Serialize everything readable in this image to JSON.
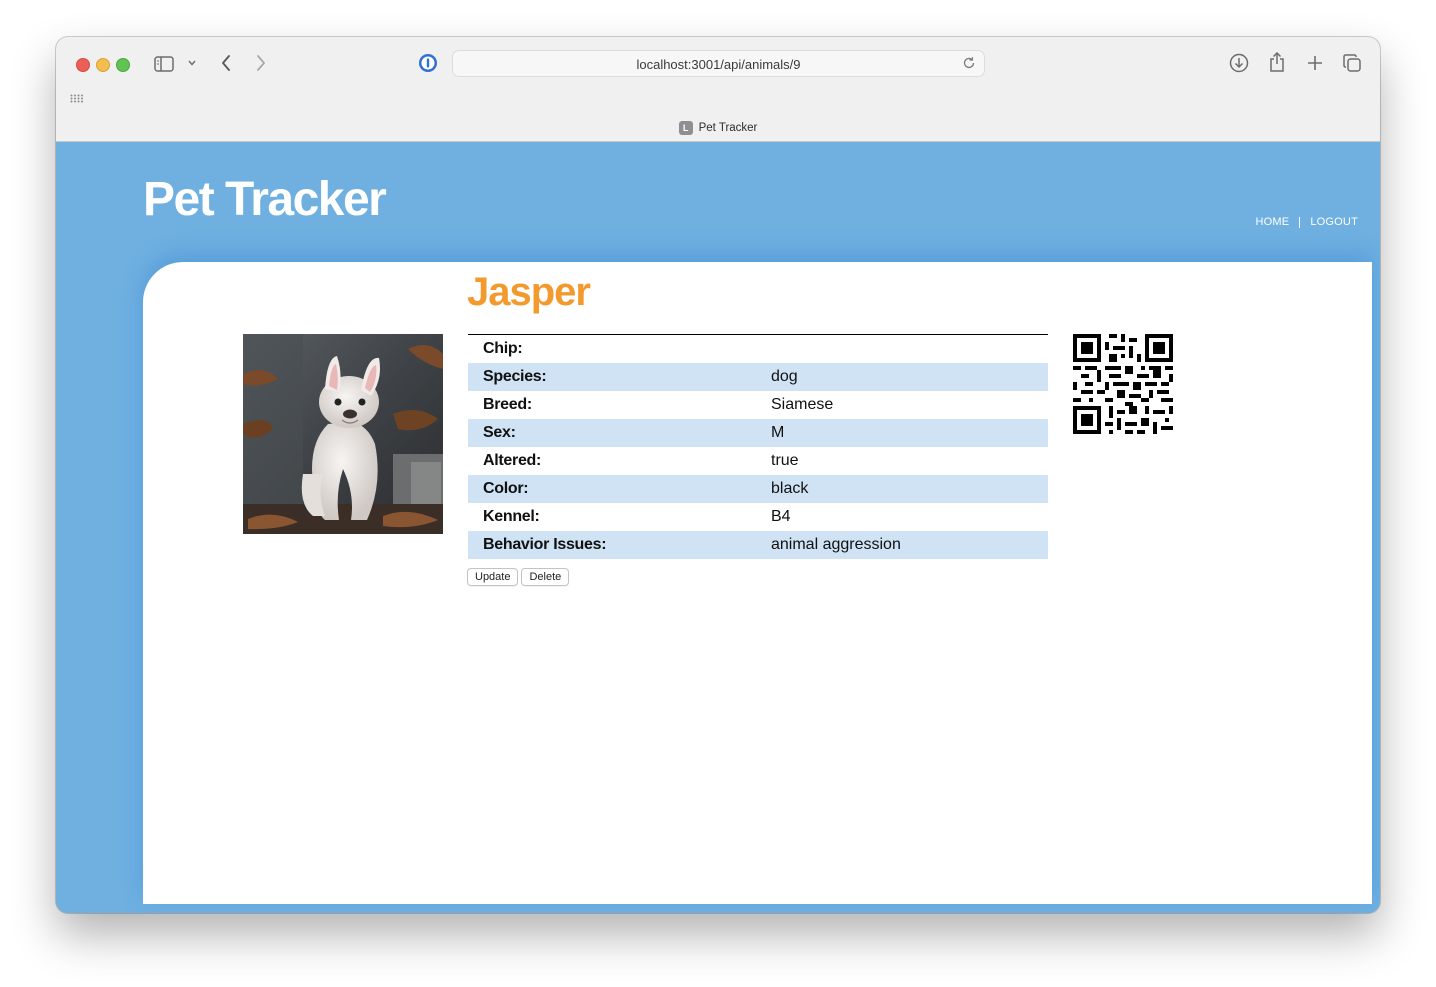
{
  "browser": {
    "url": "localhost:3001/api/animals/9",
    "tab_title": "Pet Tracker",
    "tab_favicon_letter": "L"
  },
  "site": {
    "title": "Pet Tracker",
    "nav": {
      "home": "HOME",
      "logout": "LOGOUT"
    }
  },
  "pet": {
    "name": "Jasper",
    "photo_icon": "french-bulldog-photo",
    "details": [
      {
        "label": "Chip:",
        "value": ""
      },
      {
        "label": "Species:",
        "value": "dog"
      },
      {
        "label": "Breed:",
        "value": "Siamese"
      },
      {
        "label": "Sex:",
        "value": "M"
      },
      {
        "label": "Altered:",
        "value": "true"
      },
      {
        "label": "Color:",
        "value": "black"
      },
      {
        "label": "Kennel:",
        "value": "B4"
      },
      {
        "label": "Behavior Issues:",
        "value": "animal aggression"
      }
    ]
  },
  "actions": {
    "update": "Update",
    "delete": "Delete"
  },
  "colors": {
    "header_bg": "#6fb0e1",
    "pet_name": "#f39a2e",
    "row_stripe": "#cfe3f4"
  }
}
